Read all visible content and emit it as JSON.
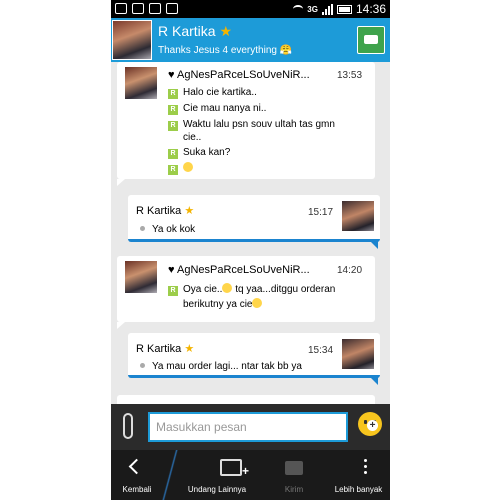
{
  "status_bar": {
    "time": "14:36",
    "network": "3G"
  },
  "header": {
    "contact_name": "R Kartika",
    "star": "★",
    "status": "Thanks Jesus 4 everything 😤"
  },
  "messages": [
    {
      "direction": "incoming",
      "sender": "AgNesPaRceLSoUveNiR...",
      "time": "13:53",
      "lines": [
        "Halo cie kartika..",
        "Cie mau nanya ni..",
        "Waktu lalu psn souv ultah tas gmn",
        "Suka kan?",
        ""
      ],
      "line3_cont": "cie.."
    },
    {
      "direction": "outgoing",
      "sender": "R Kartika",
      "time": "15:17",
      "text": "Ya ok kok"
    },
    {
      "direction": "incoming",
      "sender": "AgNesPaRceLSoUveNiR...",
      "time": "14:20",
      "line1": "Oya cie..",
      "line1_tail": " tq yaa...ditggu orderan",
      "line2": "berikutny ya cie"
    },
    {
      "direction": "outgoing",
      "sender": "R Kartika",
      "time": "15:34",
      "text": "Ya mau order lagi... ntar tak bb ya"
    }
  ],
  "compose": {
    "placeholder": "Masukkan pesan"
  },
  "nav": {
    "back_label": "Kembali",
    "invite_label": "Undang Lainnya",
    "send_label": "Kirim",
    "more_label": "Lebih banyak"
  },
  "colors": {
    "header": "#1d9bd8",
    "accent_border": "#1b84cf",
    "bbm_badge": "#9ccd4a",
    "emoji": "#f7c51e"
  }
}
